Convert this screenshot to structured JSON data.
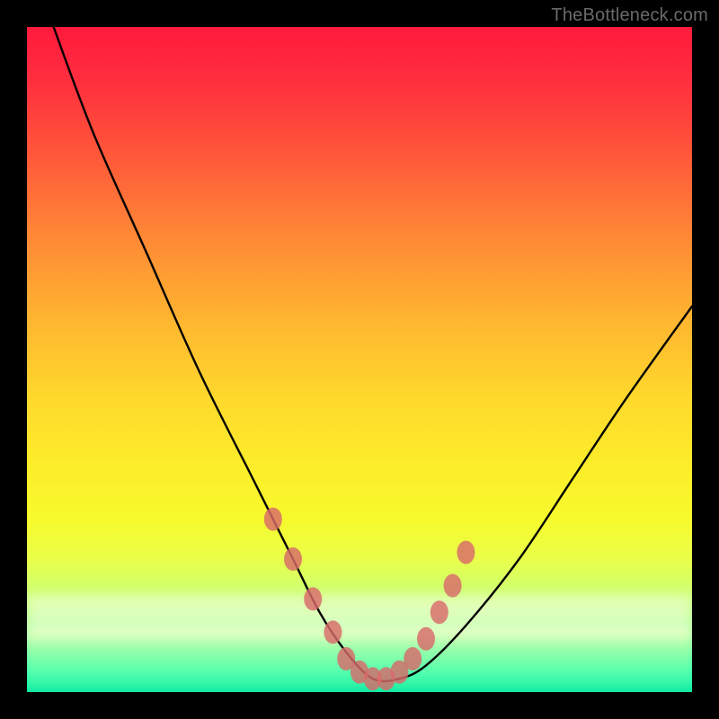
{
  "watermark": {
    "text": "TheBottleneck.com"
  },
  "chart_data": {
    "type": "line",
    "title": "",
    "xlabel": "",
    "ylabel": "",
    "xlim": [
      0,
      100
    ],
    "ylim": [
      0,
      100
    ],
    "grid": false,
    "legend_position": "none",
    "series": [
      {
        "name": "bottleneck-curve",
        "x": [
          4,
          10,
          18,
          26,
          34,
          40,
          44,
          48,
          52,
          56,
          60,
          66,
          74,
          82,
          90,
          100
        ],
        "values": [
          100,
          84,
          66,
          48,
          32,
          20,
          12,
          6,
          2,
          2,
          4,
          10,
          20,
          32,
          44,
          58
        ]
      }
    ],
    "highlight_markers": {
      "name": "marker-dots",
      "color": "#d86a6a",
      "x": [
        37,
        40,
        43,
        46,
        48,
        50,
        52,
        54,
        56,
        58,
        60,
        62,
        64,
        66
      ],
      "values": [
        26,
        20,
        14,
        9,
        5,
        3,
        2,
        2,
        3,
        5,
        8,
        12,
        16,
        21
      ]
    },
    "background_gradient": {
      "top": "#ff1a3c",
      "mid": "#ffd92c",
      "bottom": "#00e6a0"
    }
  }
}
